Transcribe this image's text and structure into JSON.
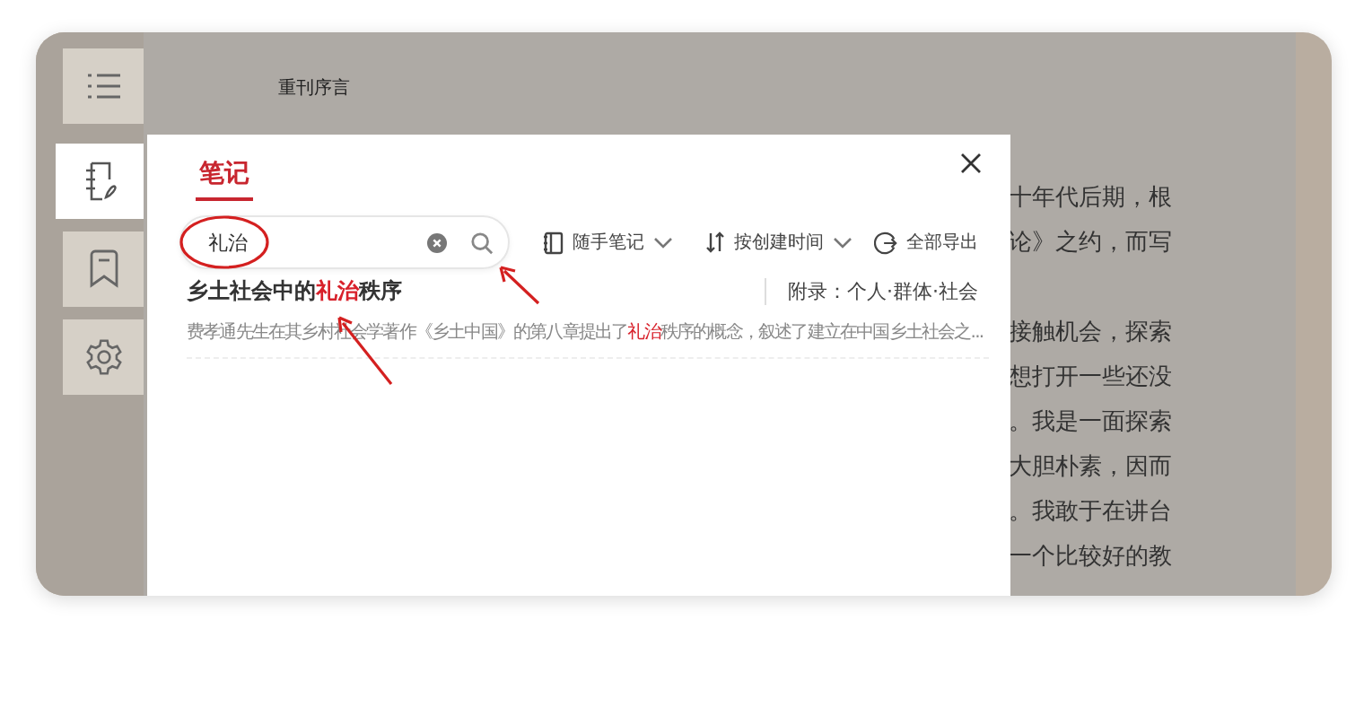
{
  "sidebar": {
    "items": [
      {
        "kind": "menu",
        "selected": false
      },
      {
        "kind": "notes",
        "selected": true
      },
      {
        "kind": "bookmark",
        "selected": false
      },
      {
        "kind": "settings",
        "selected": false
      }
    ]
  },
  "reader": {
    "heading": "重刊序言",
    "paragraphs": [
      [
        "十年代后期，根",
        "论》之约，而写"
      ],
      [
        "接触机会，探索",
        "想打开一些还没",
        "。我是一面探索",
        "大胆朴素，因而",
        "。我敢于在讲台",
        "一个比较好的教"
      ]
    ]
  },
  "notes_panel": {
    "tabs": [
      {
        "label": "笔记",
        "selected": true
      }
    ],
    "search": {
      "value": "礼治"
    },
    "filters": [
      {
        "kind": "notebook",
        "label": "随手笔记"
      },
      {
        "kind": "sort",
        "label": "按创建时间"
      },
      {
        "kind": "export",
        "label": "全部导出"
      }
    ],
    "results": [
      {
        "title": [
          {
            "text": "乡土社会中的",
            "highlight": false
          },
          {
            "text": "礼治",
            "highlight": true
          },
          {
            "text": "秩序",
            "highlight": false
          }
        ],
        "chapter": "附录：个人·群体·社会",
        "excerpt": [
          {
            "text": "费孝通先生在其乡村社会学著作《乡土中国》的第八章提出了",
            "highlight": false
          },
          {
            "text": "礼治",
            "highlight": true
          },
          {
            "text": "秩序的概念，叙述了建立在中国乡土社会之...",
            "highlight": false
          }
        ]
      }
    ]
  }
}
